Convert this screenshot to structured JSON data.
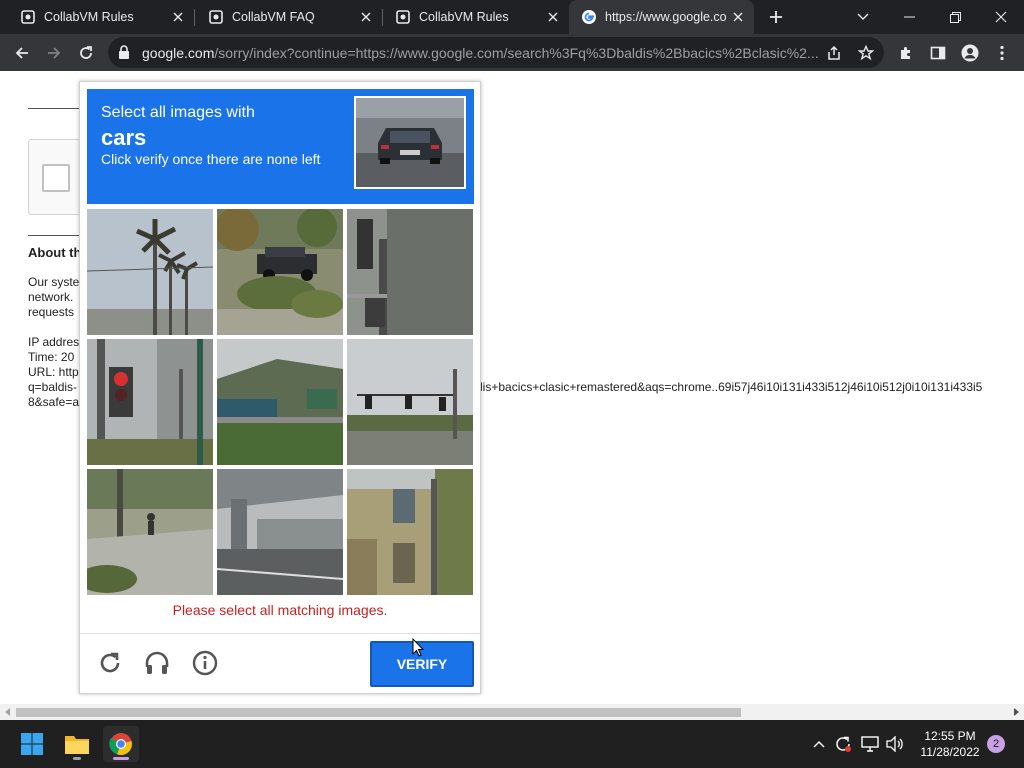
{
  "browser": {
    "tabs": [
      {
        "title": "CollabVM Rules",
        "active": false,
        "favicon": "collabvm-icon"
      },
      {
        "title": "CollabVM FAQ",
        "active": false,
        "favicon": "collabvm-icon"
      },
      {
        "title": "CollabVM Rules",
        "active": false,
        "favicon": "collabvm-icon"
      },
      {
        "title": "https://www.google.co",
        "active": true,
        "favicon": "google-icon"
      }
    ],
    "address": {
      "host": "google.com",
      "path": "/sorry/index?continue=https://www.google.com/search%3Fq%3Dbaldis%2Bbacics%2Bclasic%2..."
    }
  },
  "page": {
    "about_heading": "About th",
    "para_lines": [
      "Our syste",
      "network.",
      "requests"
    ],
    "info_lines": [
      "IP addres",
      "Time: 20",
      "URL: http",
      "q=baldis-",
      "8&safe=a"
    ],
    "url_tail": "lis+bacics+clasic+remastered&aqs=chrome..69i57j46i10i131i433i512j46i10i512j0i10i131i433i5"
  },
  "captcha": {
    "instruction_line1": "Select all images with",
    "target": "cars",
    "instruction_line3": "Click verify once there are none left",
    "error": "Please select all matching images.",
    "verify_label": "VERIFY",
    "tiles": [
      "palm-trees",
      "car-on-street",
      "traffic-light-wall",
      "traffic-light-red",
      "highway-sign",
      "traffic-signals",
      "road-pedestrian",
      "overpass",
      "building-corner"
    ]
  },
  "taskbar": {
    "time": "12:55 PM",
    "date": "11/28/2022",
    "notifications": "2"
  },
  "colors": {
    "captcha_blue": "#1a73e8",
    "error_red": "#c5221f",
    "chrome_dark": "#202124"
  }
}
